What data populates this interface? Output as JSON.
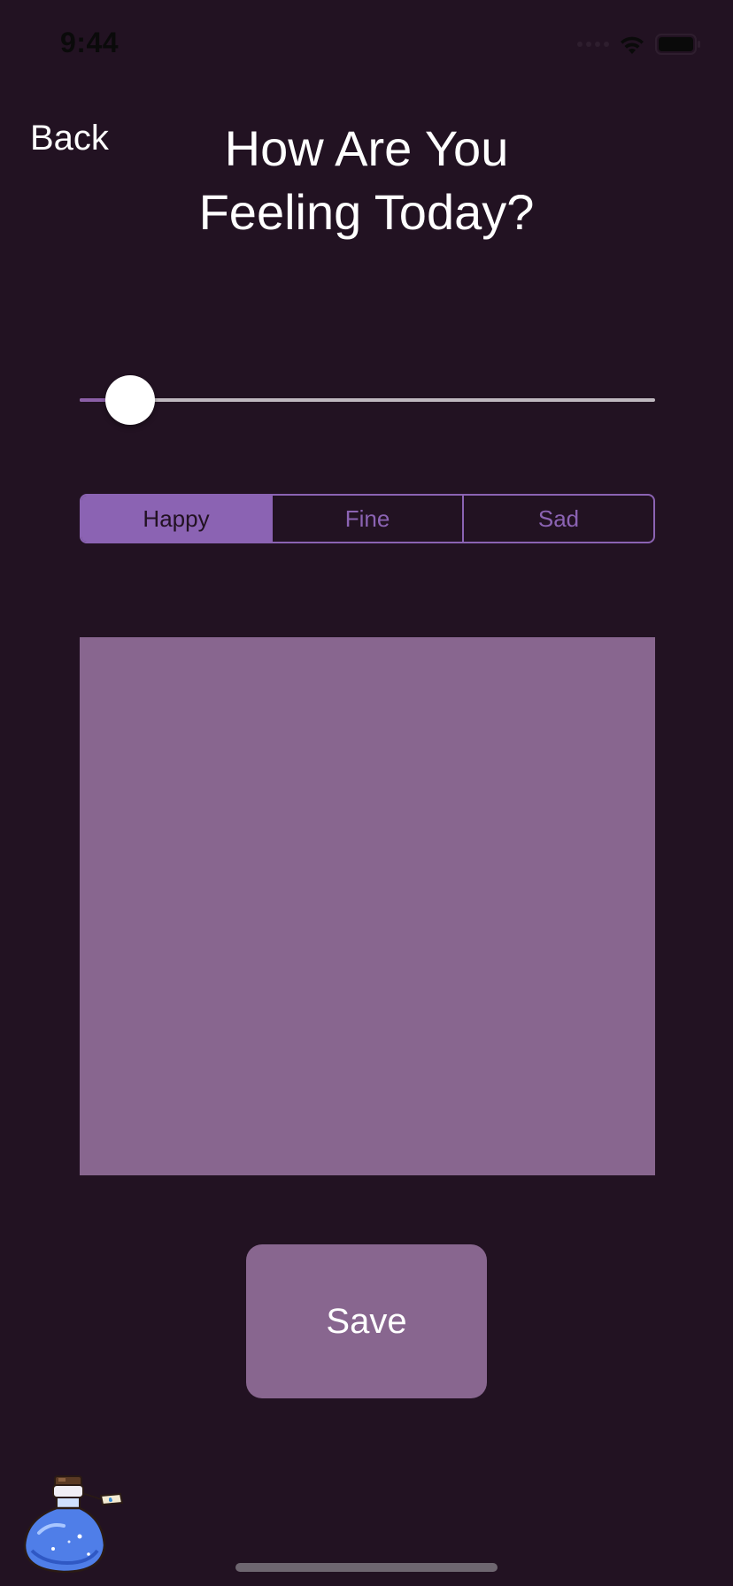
{
  "status_bar": {
    "time": "9:44"
  },
  "nav": {
    "back_label": "Back",
    "title_line1": "How Are You",
    "title_line2": "Feeling Today?"
  },
  "slider": {
    "value": 0.087
  },
  "mood_selector": {
    "options": [
      "Happy",
      "Fine",
      "Sad"
    ],
    "selected": "Happy"
  },
  "save_label": "Save",
  "icons": {
    "potion": "potion-bottle-icon",
    "wifi": "wifi-icon",
    "battery": "battery-icon"
  },
  "colors": {
    "background": "#221222",
    "accent": "#8b63b3",
    "panel": "#88668f"
  }
}
